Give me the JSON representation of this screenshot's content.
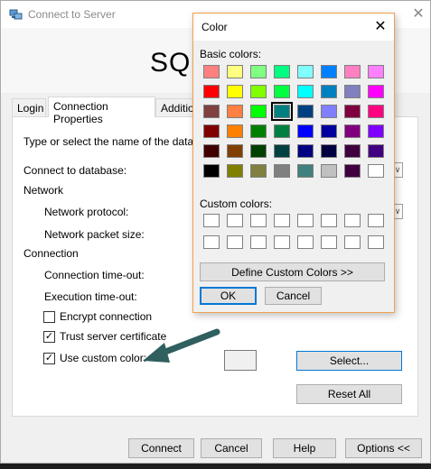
{
  "main_window": {
    "title": "Connect to Server",
    "close_glyph": "✕",
    "banner_text": "SQL"
  },
  "tabs": [
    {
      "label": "Login"
    },
    {
      "label": "Connection Properties"
    },
    {
      "label": "Additio"
    }
  ],
  "connection_properties": {
    "instruction": "Type or select the name of the database",
    "connect_to_database": "Connect to database:",
    "network_section": "Network",
    "network_protocol": "Network protocol:",
    "network_packet_size": "Network packet size:",
    "connection_section": "Connection",
    "connection_timeout": "Connection time-out:",
    "execution_timeout": "Execution time-out:",
    "encrypt_connection": {
      "label": "Encrypt connection",
      "checked": false
    },
    "trust_server_certificate": {
      "label": "Trust server certificate",
      "checked": true
    },
    "use_custom_color": {
      "label": "Use custom color:",
      "checked": true
    },
    "select_button": "Select...",
    "reset_all_button": "Reset All",
    "dropdown_glyph": "∨",
    "check_glyph": "✓"
  },
  "bottom_buttons": {
    "connect": "Connect",
    "cancel": "Cancel",
    "help": "Help",
    "options": "Options <<"
  },
  "color_dialog": {
    "title": "Color",
    "close_glyph": "✕",
    "basic_colors_label": "Basic colors:",
    "custom_colors_label": "Custom colors:",
    "define_custom_colors_button": "Define Custom Colors >>",
    "ok_button": "OK",
    "cancel_button": "Cancel",
    "basic_colors": [
      [
        "#ff8080",
        "#ffff80",
        "#80ff80",
        "#00ff80",
        "#80ffff",
        "#0080ff",
        "#ff80c0",
        "#ff80ff"
      ],
      [
        "#ff0000",
        "#ffff00",
        "#80ff00",
        "#00ff40",
        "#00ffff",
        "#0080c0",
        "#8080c0",
        "#ff00ff"
      ],
      [
        "#804040",
        "#ff8040",
        "#00ff00",
        "#008080",
        "#004080",
        "#8080ff",
        "#800040",
        "#ff0080"
      ],
      [
        "#800000",
        "#ff8000",
        "#008000",
        "#008040",
        "#0000ff",
        "#0000a0",
        "#800080",
        "#8000ff"
      ],
      [
        "#400000",
        "#804000",
        "#004000",
        "#004040",
        "#000080",
        "#000040",
        "#400040",
        "#400080"
      ],
      [
        "#000000",
        "#808000",
        "#808040",
        "#808080",
        "#408080",
        "#c0c0c0",
        "#400040",
        "#ffffff"
      ]
    ],
    "selected_color": {
      "row": 2,
      "col": 3
    },
    "custom_colors": [
      [
        "#ffffff",
        "#ffffff",
        "#ffffff",
        "#ffffff",
        "#ffffff",
        "#ffffff",
        "#ffffff",
        "#ffffff"
      ],
      [
        "#ffffff",
        "#ffffff",
        "#ffffff",
        "#ffffff",
        "#ffffff",
        "#ffffff",
        "#ffffff",
        "#ffffff"
      ]
    ]
  },
  "colors": {
    "arrow": "#2f5f5f",
    "dialog_border": "#f0a050",
    "focus_border": "#0078d7"
  }
}
